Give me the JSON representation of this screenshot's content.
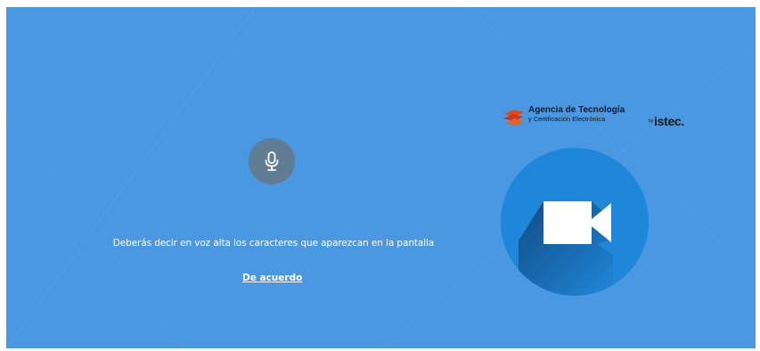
{
  "instruction": {
    "text": "Deberás decir en voz alta los caracteres que aparezcan en la pantalla"
  },
  "actions": {
    "accept_label": "De acuerdo"
  },
  "logo": {
    "line1": "Agencia de Tecnología",
    "line2": "y Certificación Electrónica",
    "by": "by",
    "istec": "istec."
  },
  "icons": {
    "mic": "microphone-icon",
    "video": "video-camera-icon",
    "logo_mark": "accv-logo-mark"
  },
  "colors": {
    "background": "#4a97e2",
    "mic_button": "#607d93",
    "video_circle": "#1f87da",
    "logo_accent": "#e24a1b"
  }
}
